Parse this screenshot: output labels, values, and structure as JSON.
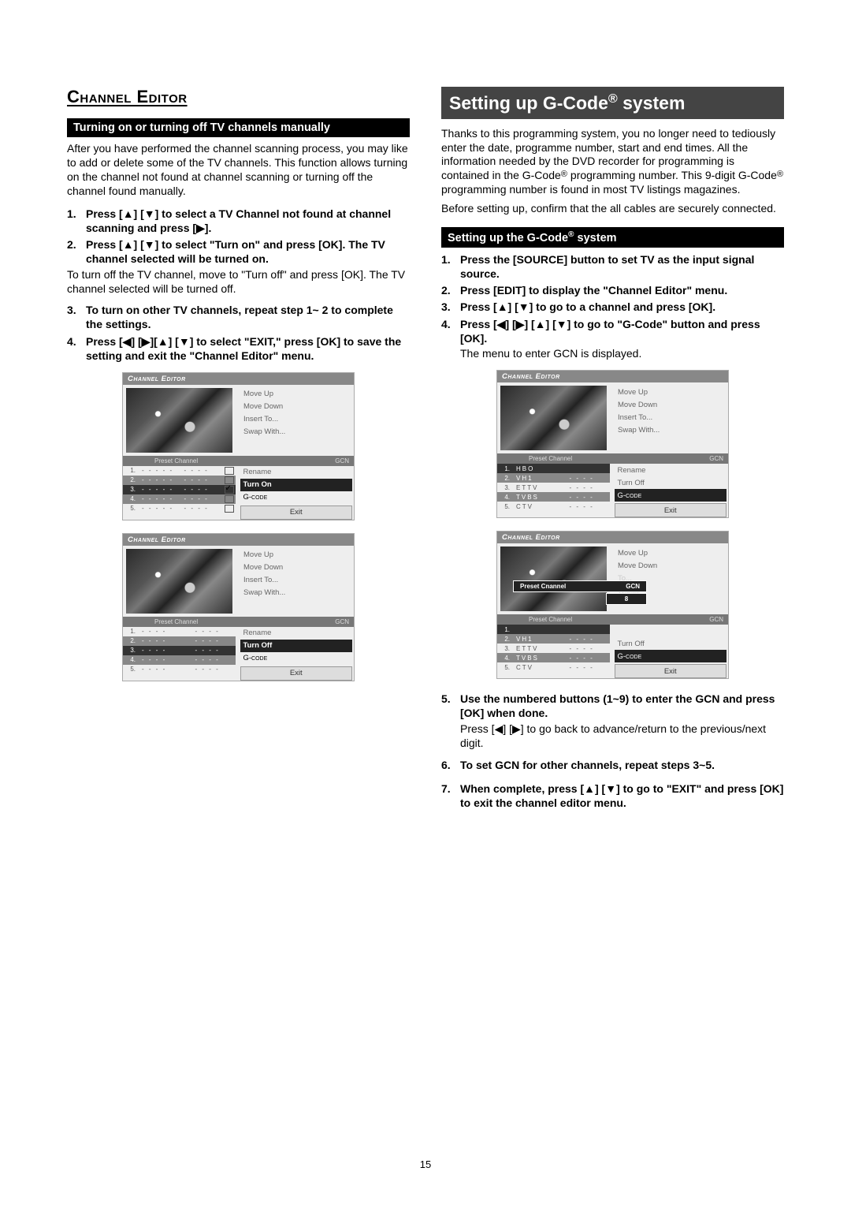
{
  "left": {
    "section_title": "Channel Editor",
    "sub_bar": "Turning on or turning off TV channels manually",
    "intro": "After you have performed the channel scanning process, you may like to add or delete some of the TV channels. This function allows turning on the channel not found at channel scanning or turning off the channel found manually.",
    "steps": {
      "s1": "Press [▲] [▼] to select a TV Channel not found at channel scanning and press [▶].",
      "s2": "Press [▲] [▼] to select \"Turn on\" and press [OK]. The TV channel selected will be turned on.",
      "s3": "To turn on other TV channels, repeat step 1~ 2 to complete the settings.",
      "s4": "Press [◀] [▶][▲] [▼] to select \"EXIT,\" press [OK] to save the setting and exit the \"Channel Editor\" menu."
    },
    "note_after2": "To turn off the TV channel, move to \"Turn off\" and press [OK]. The TV channel selected will be turned off.",
    "ui": {
      "title": "Channel Editor",
      "menu": [
        "Move Up",
        "Move Down",
        "Insert To...",
        "Swap With...",
        "Rename"
      ],
      "turn_on": "Turn On",
      "turn_off": "Turn Off",
      "gcode": "G-code",
      "exit": "Exit",
      "header_preset": "Preset Channel",
      "header_gcn": "GCN",
      "rows_a": [
        {
          "n": "1.",
          "name": "- - - - -",
          "g": "- - - -"
        },
        {
          "n": "2.",
          "name": "- - - - -",
          "g": "- - - -"
        },
        {
          "n": "3.",
          "name": "- - - - -",
          "g": "- - - -"
        },
        {
          "n": "4.",
          "name": "- - - - -",
          "g": "- - - -"
        },
        {
          "n": "5.",
          "name": "- - - - -",
          "g": "- - - -"
        }
      ],
      "rows_b": [
        {
          "n": "1.",
          "name": "- - - -",
          "g": "- - - -"
        },
        {
          "n": "2.",
          "name": "- - - -",
          "g": "- - - -"
        },
        {
          "n": "3.",
          "name": "- - - -",
          "g": "- - - -"
        },
        {
          "n": "4.",
          "name": "- - - -",
          "g": "- - - -"
        },
        {
          "n": "5.",
          "name": "- - - -",
          "g": "- - - -"
        }
      ]
    }
  },
  "right": {
    "hero": "Setting up G-Code® system",
    "intro1": "Thanks to this programming system, you no longer need to tediously enter the date, programme number, start and end times. All the information needed by the DVD recorder for programming is contained in the G-Code® programming number. This 9-digit G-Code® programming number is found in most TV listings magazines.",
    "intro2": "Before setting up, confirm that the all cables are securely connected.",
    "sub_bar": "Setting up the G-Code® system",
    "steps": {
      "s1": "Press the [SOURCE] button to set TV as the input signal source.",
      "s2": "Press [EDIT] to display the \"Channel Editor\" menu.",
      "s3": "Press [▲] [▼]  to go to a channel and press [OK].",
      "s4": "Press [◀] [▶] [▲] [▼]  to go to \"G-Code\" button and press [OK].",
      "s5": "Use the numbered buttons (1~9) to enter the GCN and press [OK] when done.",
      "s6": "To set GCN  for other channels, repeat steps 3~5.",
      "s7": "When complete, press [▲] [▼]  to go to \"EXIT\" and press [OK] to exit the channel editor menu."
    },
    "note4": "The menu to enter GCN is displayed.",
    "note5": "Press [◀] [▶]  to go back to advance/return to the previous/next digit.",
    "ui": {
      "title": "Channel Editor",
      "menu": [
        "Move Up",
        "Move Down",
        "Insert To...",
        "Swap With...",
        "Rename",
        "Turn Off"
      ],
      "gcode": "G-code",
      "exit": "Exit",
      "header_preset": "Preset Channel",
      "header_gcn": "GCN",
      "rows": [
        {
          "n": "1.",
          "name": "HBO",
          "g": ""
        },
        {
          "n": "2.",
          "name": "VH1",
          "g": "- - - -"
        },
        {
          "n": "3.",
          "name": "ETTV",
          "g": "- - - -"
        },
        {
          "n": "4.",
          "name": "TVBS",
          "g": "- - - -"
        },
        {
          "n": "5.",
          "name": "CTV",
          "g": "- - - -"
        }
      ],
      "overlay_preset": "Preset Cnannel",
      "overlay_gcn_label": "GCN",
      "overlay_gcn_value": "8"
    }
  },
  "page": "15"
}
